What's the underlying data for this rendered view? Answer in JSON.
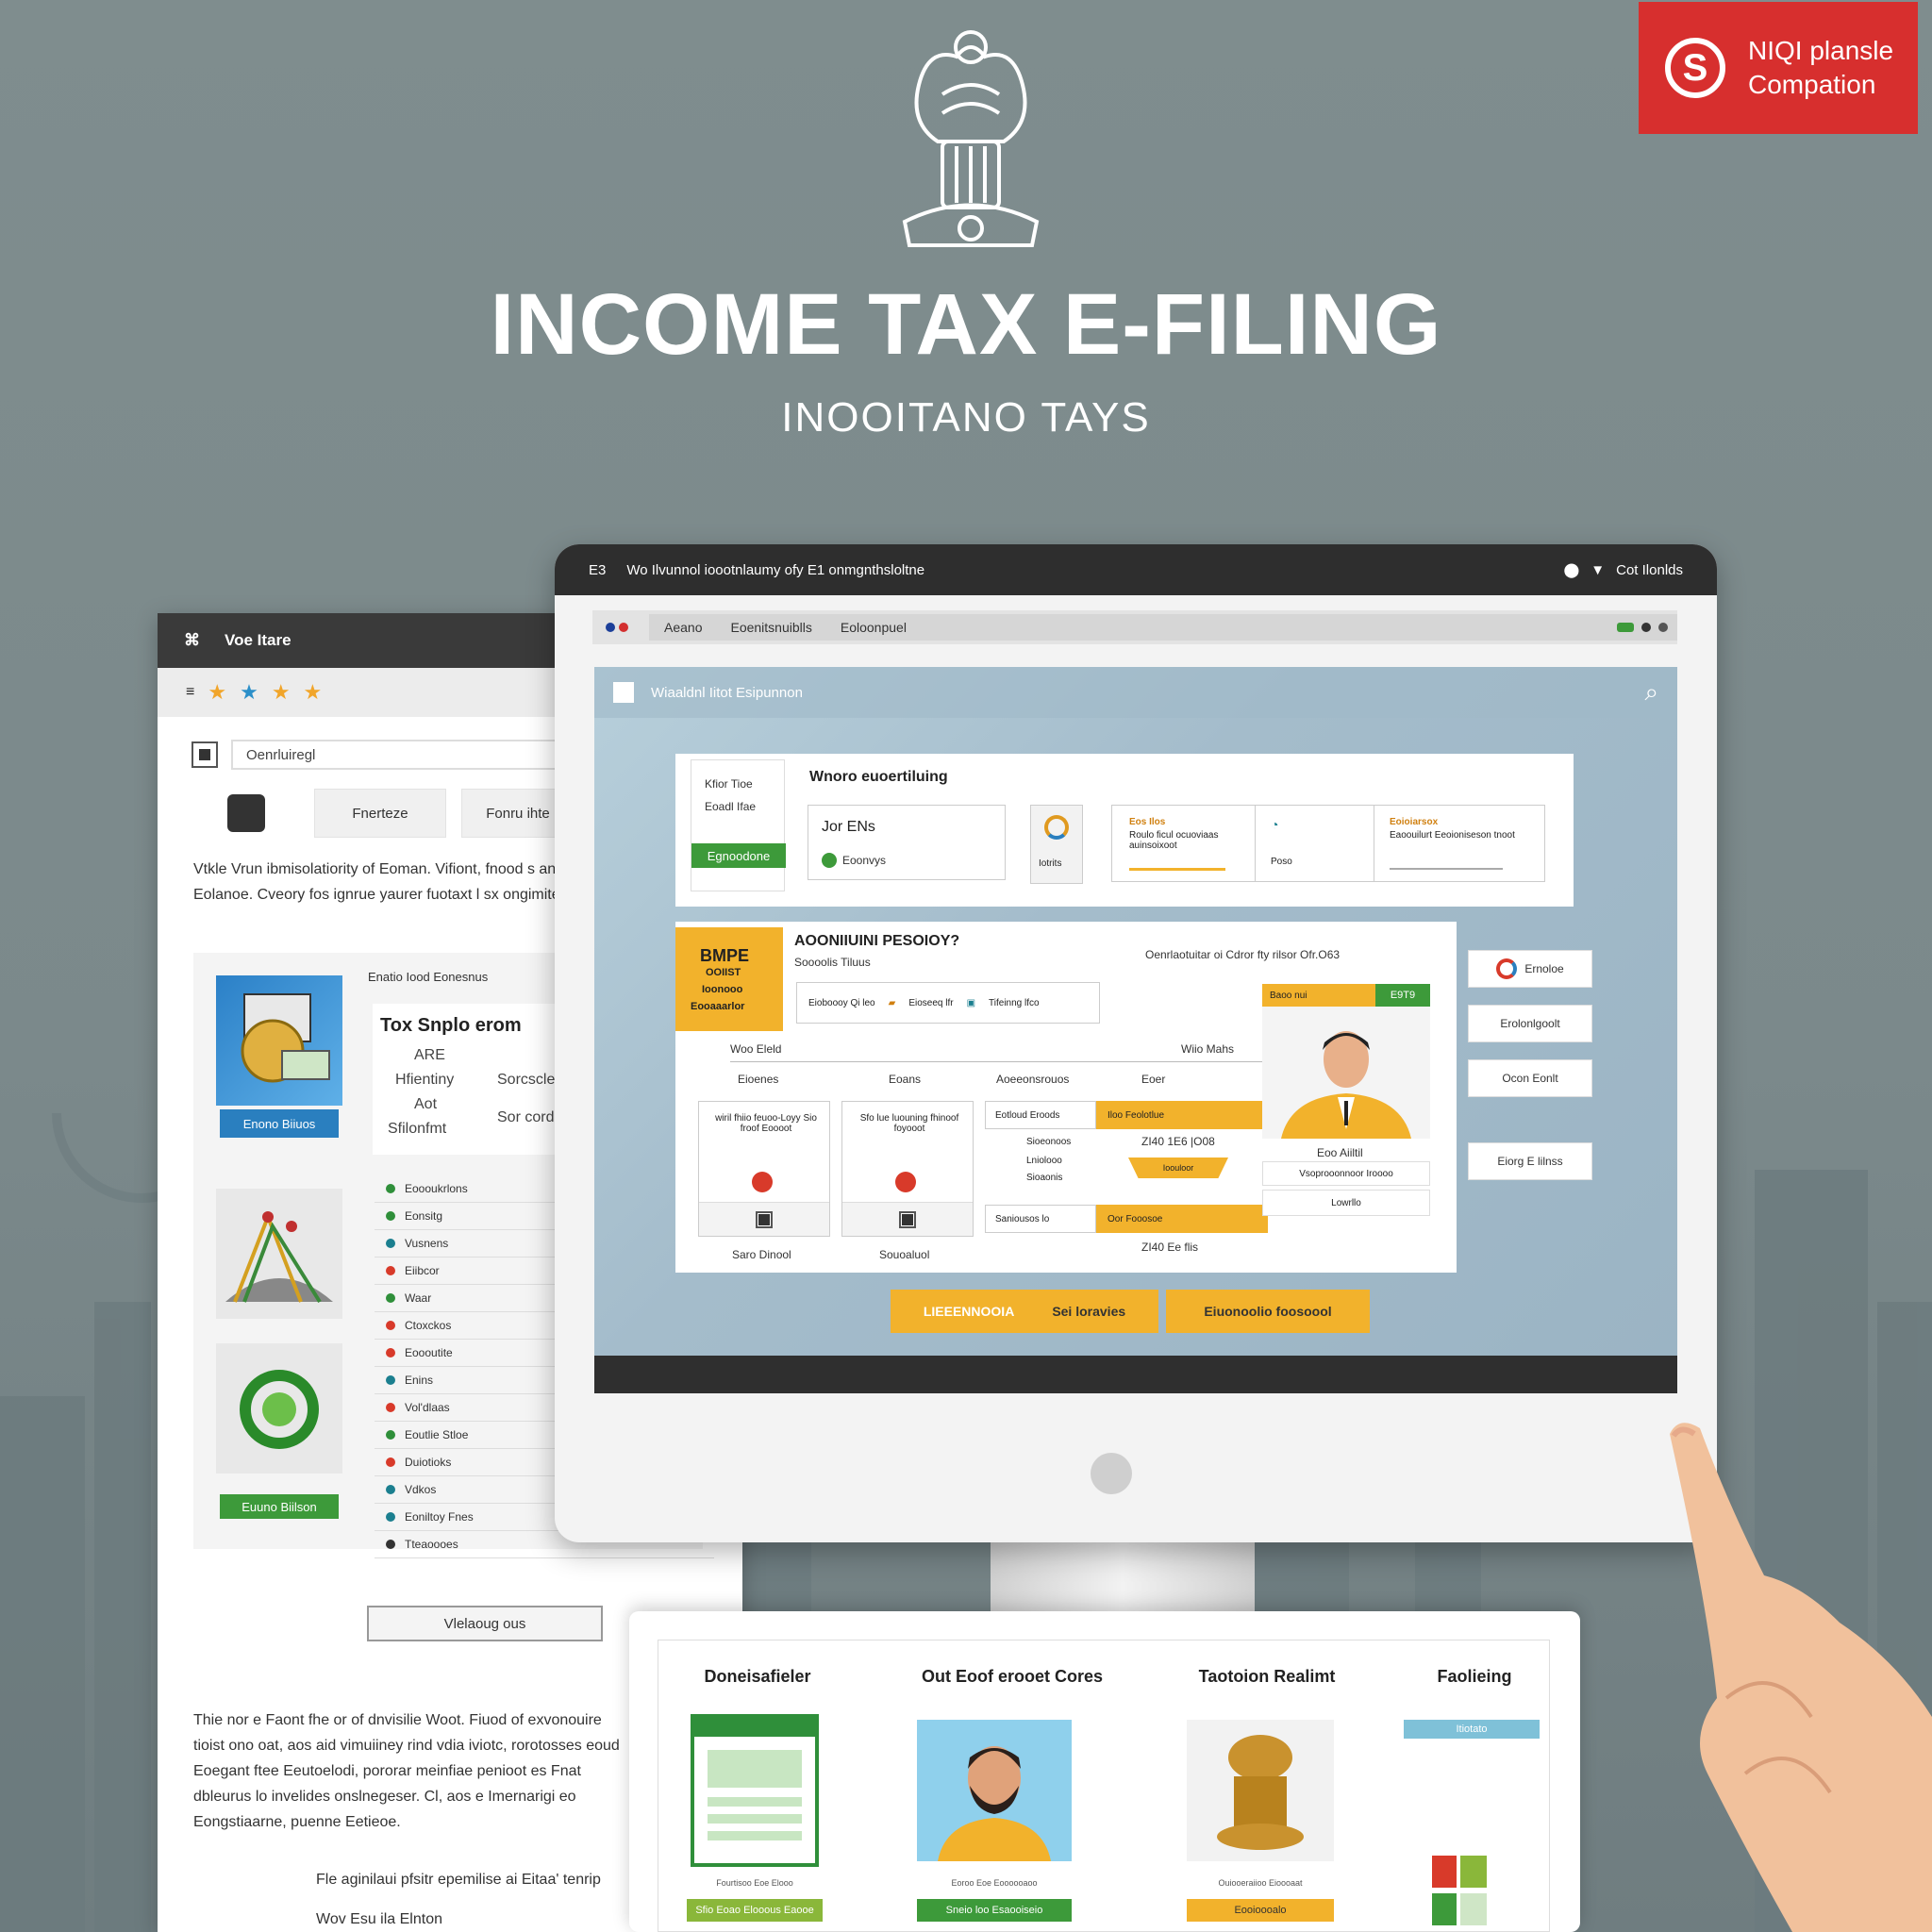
{
  "header": {
    "title": "INCOME TAX E-FILING",
    "subtitle": "INOOITANO TAYS"
  },
  "badge": {
    "icon": "S",
    "line1": "NIQI plansle",
    "line2": "Compation"
  },
  "left_window": {
    "title": "Voe Itare",
    "search_placeholder": "Oenrluiregl",
    "button1": "Fnerteze",
    "button2": "Fonru ihte",
    "paragraph": "Vtkle Vrun ibmisolatiority of Eoman. Vifiont, fnood s anb Eolanoe. Cveory fos ignrue yaurer fuotaxt l sx ongimiteit.",
    "card_label": "Enatio Iood Eonesnus",
    "card_heading": "Tox Snplo erom",
    "card_line1": "ARE",
    "card_line2": "Hfientiny",
    "card_line3": "Aot",
    "card_line4": "Sfilonfmt",
    "card_right1": "Sorcscle",
    "card_right2": "Sor corde",
    "card_btn1": "Enono Biiuos",
    "card_btn2": "Euuno Biilson",
    "list": [
      "Eoooukrlons",
      "Eonsitg",
      "Vusnens",
      "Eiibcor",
      "Waar",
      "Ctoxckos",
      "Eoooutite",
      "Enins",
      "Vol'dlaas",
      "Eoutlie Stloe",
      "Duiotioks",
      "Vdkos",
      "Eoniltoy Fnes",
      "Tteaoooes"
    ],
    "footer_button": "Vlelaoug ous",
    "footer_para": "Thie nor e Faont fhe or of dnvisilie Woot. Fiuod of exvonouire tioist ono oat, aos aid vimuiiney rind vdia iviotc, rorotosses eoud Eoegant ftee Eeutoelodi, pororar meinfiae penioot es Fnat dbleurus lo invelides onslnegeser. Cl, aos e Imernarigi eo Eongstiaarne, puenne Eetieoe.",
    "footer_line1": "Fle aginilaui pfsitr epemilise ai Eitaa' tenrip",
    "footer_line2": "Wov Esu ila Elnton"
  },
  "monitor": {
    "top_left": "E3",
    "top_title": "Wo Ilvunnol ioootnlaumy ofy E1 onmgnthsloltne",
    "top_right": "Cot Ilonlds",
    "addr1": "Aeano",
    "addr2": "Eoenitsnuiblls",
    "addr3": "Eoloonpuel",
    "screen_title": "Wiaaldnl Iitot Esipunnon",
    "section1": {
      "left_line1": "Kfior Tioe",
      "left_line2": "Eoadl Ifae",
      "left_btn": "Egnoodone",
      "title": "Wnoro euoertiluing",
      "field_value": "Jor ENs",
      "field_sub": "Eoonvys",
      "icon_label": "Iotrits",
      "box1_title": "Eos Ilos",
      "box1_text": "Roulo ficul ocuoviaas auinsoixoot",
      "box2_text": "Poso",
      "box3_title": "Eoioiarsox",
      "box3_text": "Eaoouilurt Eeoioniseson tnoot"
    },
    "section2": {
      "tag_line1": "BMPE",
      "tag_line2": "OOIIST",
      "tag_line3": "Ioonooo",
      "tag_line4": "Eooaaarlor",
      "title": "AOONIIUINI PESOIOY?",
      "subtitle": "Soooolis Tiluus",
      "right_text": "Oenrlaotuitar oi Cdror fty rilsor Ofr.O63",
      "chip1": "Eioboooy Qi leo",
      "chip2": "Eioseeq lfr",
      "chip3": "Tifeinng lfco",
      "col_header1": "Woo Eleld",
      "col_header2": "Wiio Mahs",
      "col1_label": "Eioenes",
      "col2_label": "Eoans",
      "col3_label": "Aoeeonsrouos",
      "col4_label": "Eoer",
      "card1_text": "wiril fhiio feuoo-Loyy Sio froof Eoooot",
      "card2_text": "Sfo lue luouning fhinoof foyooot",
      "foot1": "Saro Dinool",
      "foot2": "Souoaluol",
      "row1_label": "Eotloud Eroods",
      "row1_value": "Iloo Feolotlue",
      "row2_label": "Sioeonoos",
      "row2_value": "ZI40 1E6 |O08",
      "row3_label": "Lniolooo",
      "row4_label": "Sioaonis",
      "row4_value": "Ioouloor",
      "row5_label": "Saniousos lo",
      "row5_value": "Oor Fooosoe",
      "foot3": "ZI40 Ee flis",
      "profile_tag": "Baoo nui",
      "profile_num": "E9T9",
      "profile_name": "Eoo Aiiltil",
      "profile_line": "Vsoprooonnoor Iroooo",
      "profile_btn": "Lowrllo"
    },
    "side_buttons": [
      "Ernoloe",
      "Erolonlgoolt",
      "Ocon Eonlt",
      "Eiorg E lilnss"
    ],
    "cta1_a": "LIEEENNOOIA",
    "cta1_b": "Sei loravies",
    "cta2": "Eiuonoolio foosoool"
  },
  "bottom_card": {
    "col1_title": "Doneisafieler",
    "col1_caption": "Fourtisoo Eoe Elooo",
    "col1_btn": "Sfio Eoao Elooous Eaooe",
    "col2_title": "Out Eoof erooet Cores",
    "col2_caption": "Eoroo Eoe Eoooooaoo",
    "col2_btn": "Sneio loo Esaooiseio",
    "col3_title": "Taotoion Realimt",
    "col3_caption": "Ouiooeraiioo Eioooaat",
    "col3_btn": "Eooioooalo",
    "col4_title": "Faolieing",
    "col4_btn": "Itiotato"
  },
  "colors": {
    "background": "#7f8d8e",
    "accent_yellow": "#f2b22c",
    "badge_red": "#d72f2e",
    "green": "#3d9a3a",
    "blue": "#2a7fbf"
  }
}
